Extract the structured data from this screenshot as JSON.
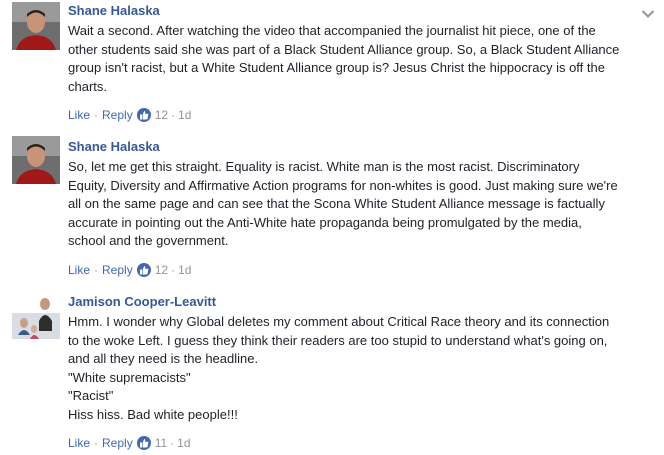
{
  "comments": [
    {
      "author": "Shane Halaska",
      "lines": [
        "Wait a second. After watching the video that accompanied the journalist hit piece, one of the",
        "other students said she was part of a Black Student Alliance group. So, a Black Student Alliance",
        "group isn't racist, but a White Student Alliance group is? Jesus Christ the hippocracy is off the",
        "charts."
      ],
      "like_label": "Like",
      "reply_label": "Reply",
      "likes": "12",
      "time": "1d"
    },
    {
      "author": "Shane Halaska",
      "lines": [
        "So, let me get this straight. Equality is racist. White man is the most racist. Discriminatory",
        "Equity, Diversity and Affirmative Action programs for non-whites is good. Just making sure we're",
        "all on the same page and can see that the Scona White Student Alliance message is factually",
        "accurate in pointing out the Anti-White hate propaganda being promulgated by the media,",
        "school and the government."
      ],
      "like_label": "Like",
      "reply_label": "Reply",
      "likes": "12",
      "time": "1d"
    },
    {
      "author": "Jamison Cooper-Leavitt",
      "lines": [
        "Hmm. I wonder why Global deletes my comment about Critical Race theory and its connection",
        "to the woke Left. I guess they think their readers are too stupid to understand what's going on,",
        "and all they need is the headline.",
        "\"White supremacists\"",
        "\"Racist\"",
        "Hiss hiss. Bad white people!!!"
      ],
      "like_label": "Like",
      "reply_label": "Reply",
      "likes": "11",
      "time": "1d"
    }
  ],
  "separator": "·",
  "colors": {
    "link": "#365899",
    "action": "#4267b2",
    "meta": "#90949c",
    "text": "#1d2129"
  },
  "icons": {
    "menu": "chevron-down-icon",
    "like": "thumbs-up-icon"
  }
}
